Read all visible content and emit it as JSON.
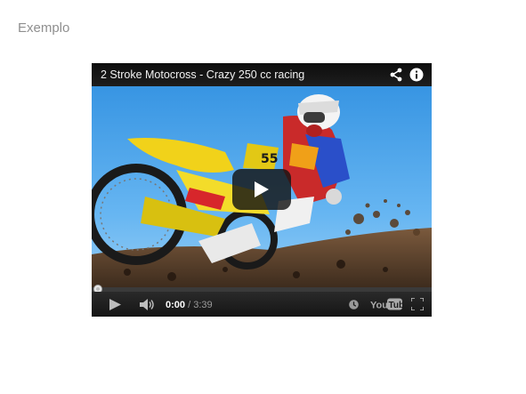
{
  "page": {
    "heading": "Exemplo"
  },
  "player": {
    "title": "2 Stroke Motocross - Crazy 250 cc racing",
    "current_time": "0:00",
    "separator": " / ",
    "duration": "3:39",
    "progress_fraction": 0,
    "logo_text": "YouTube",
    "icons": [
      "share-icon",
      "info-icon",
      "play-icon",
      "volume-icon",
      "watch-later-icon",
      "youtube-logo",
      "fullscreen-icon"
    ]
  }
}
